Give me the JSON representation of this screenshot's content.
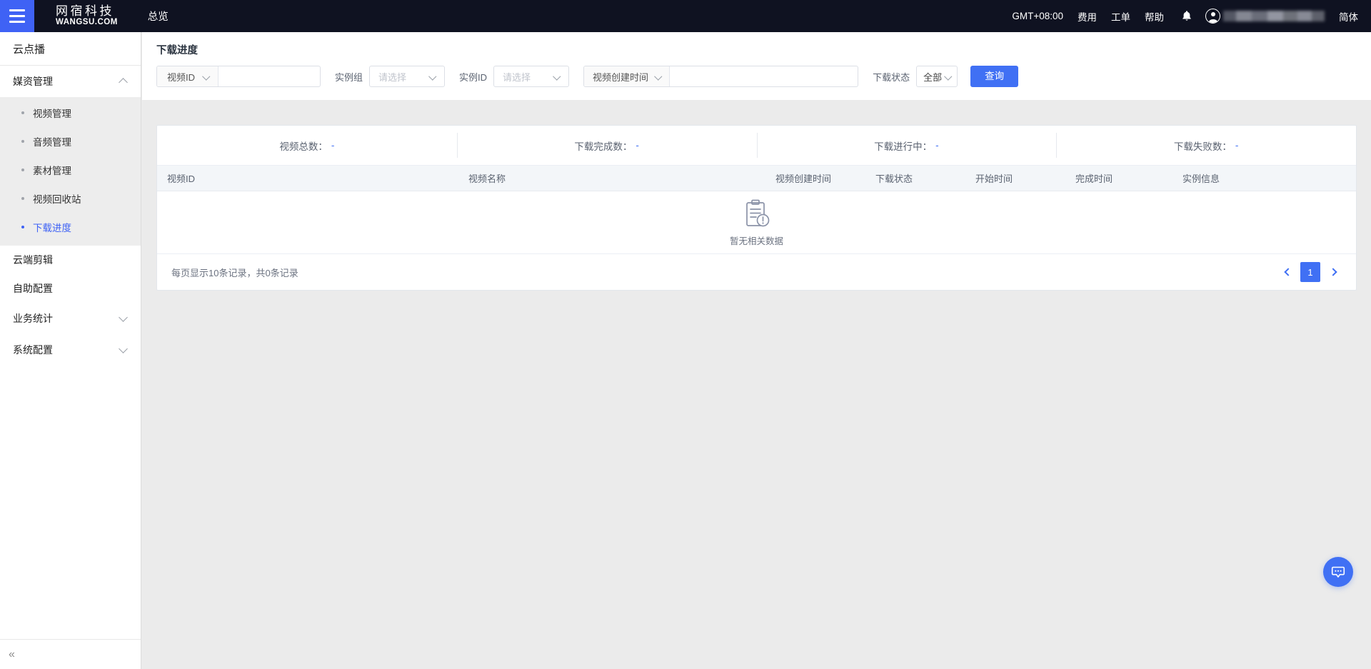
{
  "header": {
    "menu_icon": "hamburger-icon",
    "brand_cn": "网宿科技",
    "brand_en": "WANGSU.COM",
    "overview_label": "总览",
    "timezone": "GMT+08:00",
    "fee_label": "费用",
    "ticket_label": "工单",
    "help_label": "帮助",
    "bell_icon": "bell-icon",
    "avatar_icon": "user-avatar-icon",
    "username_masked": "",
    "lang_label": "简体"
  },
  "sidebar": {
    "title": "云点播",
    "groups": [
      {
        "label": "媒资管理",
        "expanded": true,
        "items": [
          {
            "label": "视频管理",
            "active": false
          },
          {
            "label": "音频管理",
            "active": false
          },
          {
            "label": "素材管理",
            "active": false
          },
          {
            "label": "视频回收站",
            "active": false
          },
          {
            "label": "下载进度",
            "active": true
          }
        ]
      }
    ],
    "links": [
      {
        "label": "云端剪辑"
      },
      {
        "label": "自助配置"
      }
    ],
    "collapsed_groups": [
      {
        "label": "业务统计"
      },
      {
        "label": "系统配置"
      }
    ],
    "collapse_icon": "collapse-sidebar-icon",
    "collapse_glyph": "«"
  },
  "filters": {
    "page_title": "下载进度",
    "video_id": {
      "select_label": "视频ID",
      "input_value": "",
      "input_placeholder": ""
    },
    "instance_group": {
      "label": "实例组",
      "placeholder": "请选择",
      "value": ""
    },
    "instance_id": {
      "label": "实例ID",
      "placeholder": "请选择",
      "value": ""
    },
    "create_time": {
      "select_label": "视频创建时间",
      "input_value": "",
      "input_placeholder": ""
    },
    "download_status": {
      "label": "下载状态",
      "value": "全部"
    },
    "query_button": "查询"
  },
  "stats": [
    {
      "label": "视频总数：",
      "value": "-"
    },
    {
      "label": "下载完成数：",
      "value": "-"
    },
    {
      "label": "下载进行中：",
      "value": "-"
    },
    {
      "label": "下载失败数：",
      "value": "-"
    }
  ],
  "table": {
    "columns": [
      "视频ID",
      "视频名称",
      "视频创建时间",
      "下载状态",
      "开始时间",
      "完成时间",
      "实例信息"
    ],
    "rows": [],
    "empty_icon": "no-data-clipboard-icon",
    "empty_text": "暂无相关数据"
  },
  "pagination": {
    "info": "每页显示10条记录，共0条记录",
    "prev_icon": "chevron-left-icon",
    "next_icon": "chevron-right-icon",
    "current_page": "1"
  },
  "fab": {
    "icon": "chat-bubble-icon"
  },
  "colors": {
    "accent": "#4070f4",
    "header_bg": "#0f1221",
    "page_bg": "#ebebeb",
    "submenu_bg": "#ededed"
  }
}
